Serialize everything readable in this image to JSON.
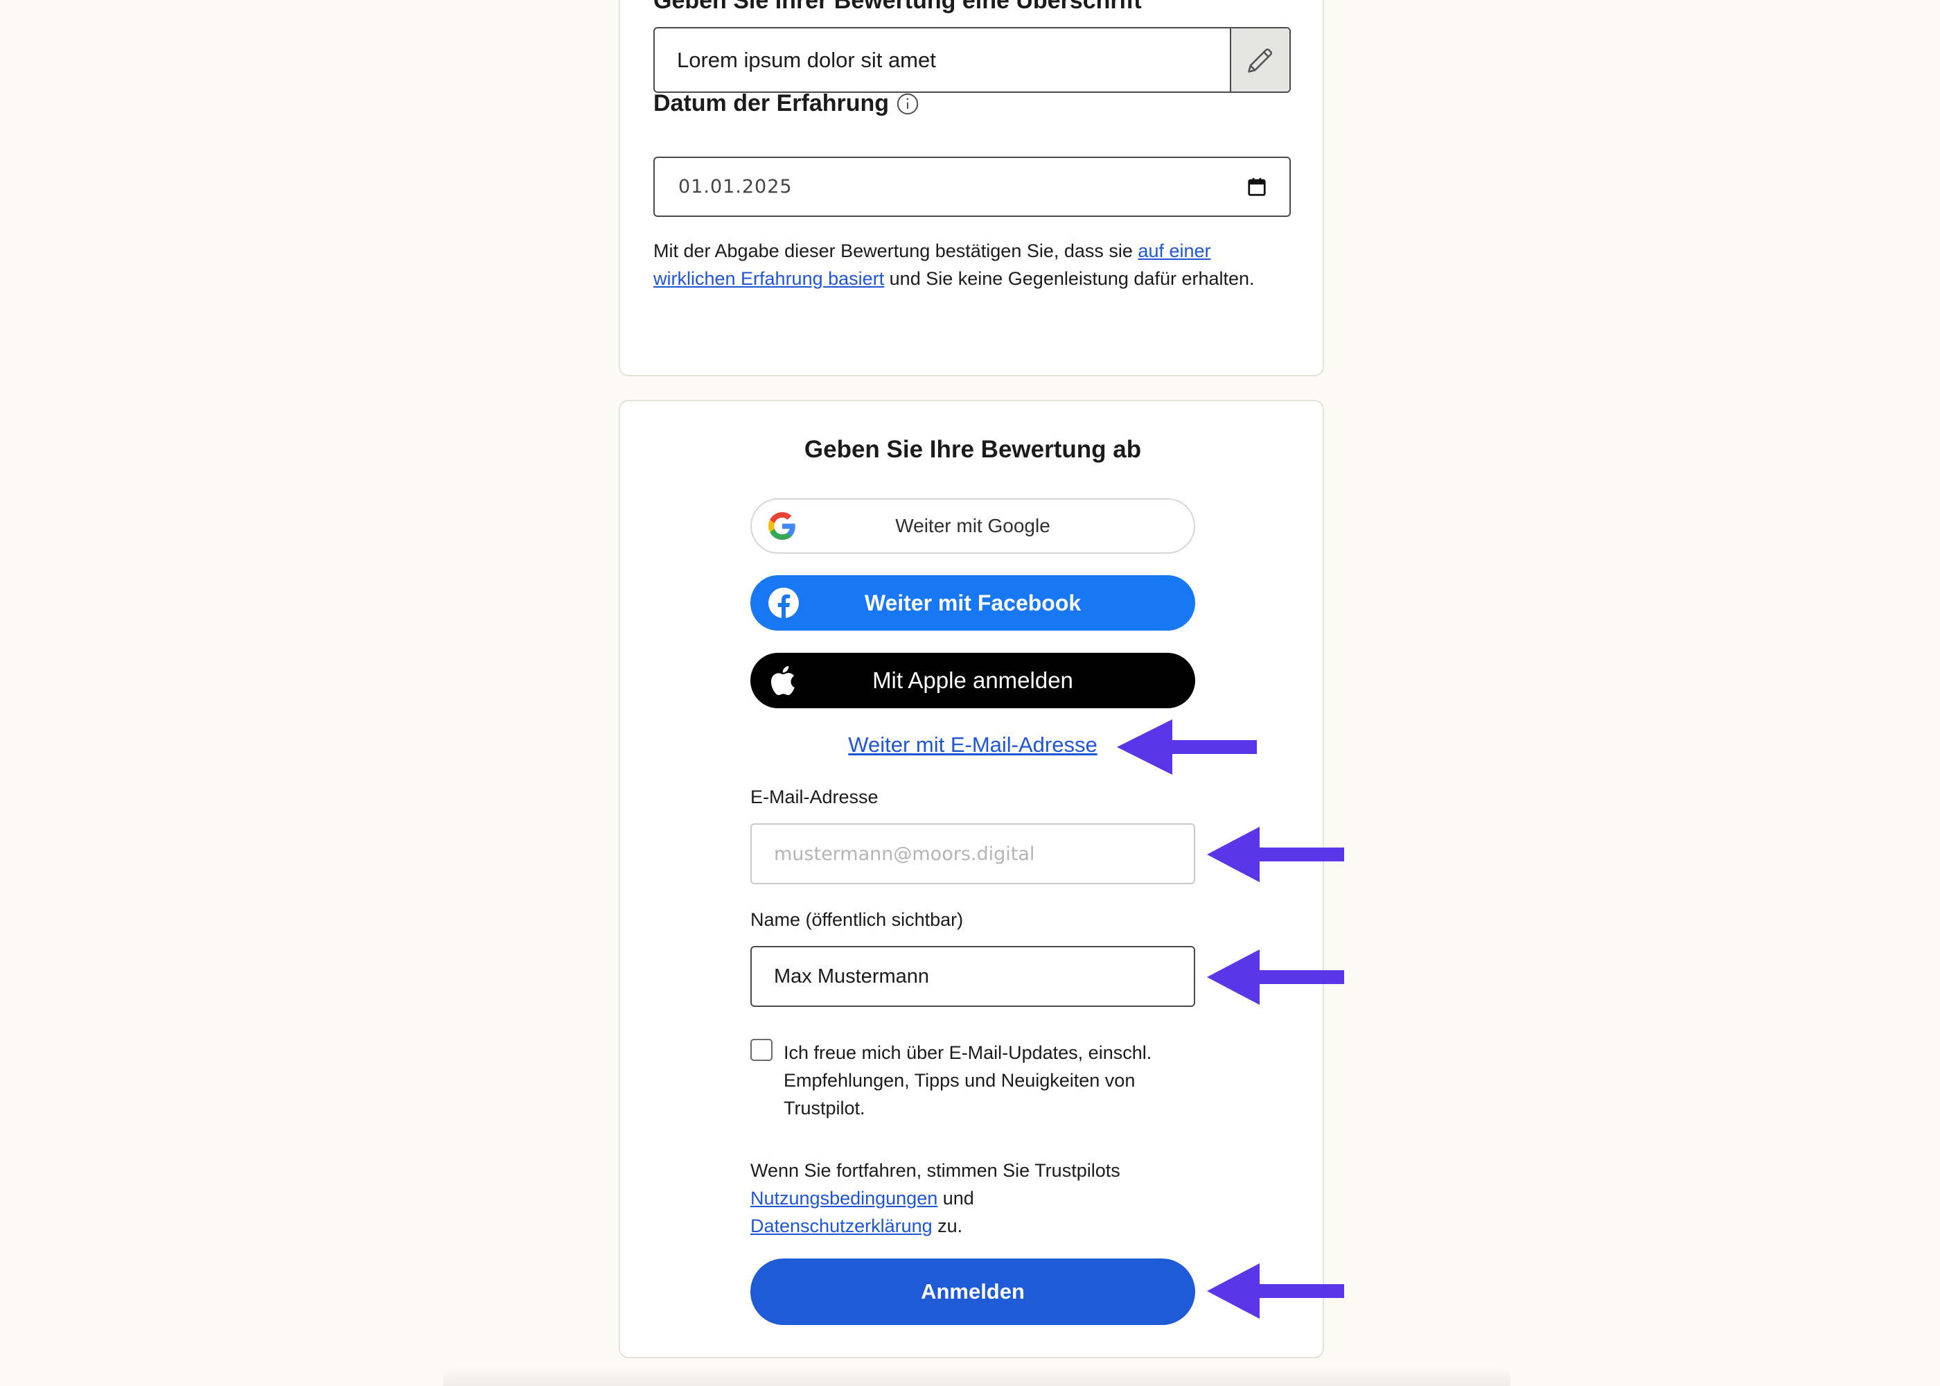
{
  "review_form": {
    "heading_title": "Geben Sie Ihrer Bewertung eine Überschrift",
    "title_value": "Lorem ipsum dolor sit amet",
    "date_label": "Datum der Erfahrung",
    "date_value": "01.01.2025",
    "confirm_text_before": "Mit der Abgabe dieser Bewertung bestätigen Sie, dass sie ",
    "confirm_link": "auf einer wirklichen Erfahrung basiert",
    "confirm_text_after": " und Sie keine Gegenleistung dafür erhalten."
  },
  "submit_section": {
    "heading": "Geben Sie Ihre Bewertung ab",
    "google_button": "Weiter mit Google",
    "facebook_button": "Weiter mit Facebook",
    "apple_button": "Mit Apple anmelden",
    "email_link": "Weiter mit E-Mail-Adresse",
    "email_label": "E-Mail-Adresse",
    "email_placeholder": "mustermann@moors.digital",
    "name_label": "Name (öffentlich sichtbar)",
    "name_value": "Max Mustermann",
    "newsletter_text": "Ich freue mich über E-Mail-Updates, einschl. Empfehlungen, Tipps und Neuigkeiten von Trustpilot.",
    "terms_before": "Wenn Sie fortfahren, stimmen Sie Trustpilots ",
    "terms_link": "Nutzungsbedingungen",
    "terms_middle": " und ",
    "privacy_link": "Datenschutzerklärung",
    "terms_after": " zu.",
    "login_button": "Anmelden"
  },
  "colors": {
    "background": "#fcfbf3",
    "link": "#1f56d6",
    "facebook": "#1877f2",
    "primary_button": "#1f5bd6",
    "annotation_arrow": "#5b35e8"
  },
  "icons": [
    "pencil-icon",
    "info-icon",
    "calendar-icon",
    "google-icon",
    "facebook-icon",
    "apple-icon",
    "arrow-left-icon"
  ]
}
